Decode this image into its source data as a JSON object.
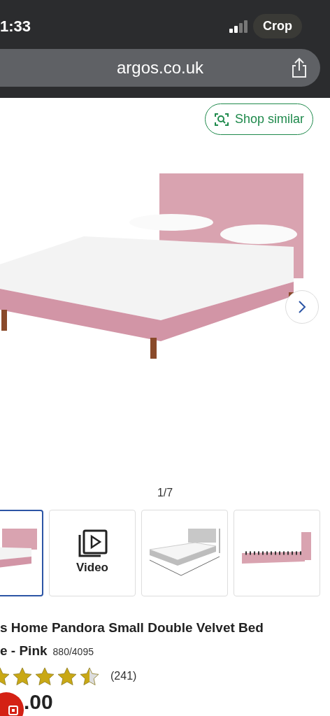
{
  "status_bar": {
    "time": "1:33",
    "crop_label": "Crop"
  },
  "address_bar": {
    "url": "argos.co.uk"
  },
  "shop_similar": {
    "label": "Shop similar"
  },
  "gallery": {
    "counter": "1/7",
    "thumbnails": [
      {
        "kind": "photo",
        "selected": true
      },
      {
        "kind": "video",
        "label": "Video",
        "selected": false
      },
      {
        "kind": "diagram",
        "selected": false
      },
      {
        "kind": "frame",
        "selected": false
      }
    ]
  },
  "product": {
    "title_line_1": "s Home Pandora Small Double Velvet Bed",
    "title_line_2": "e - Pink",
    "catalogue_number": "880/4095",
    "stars": 4.5,
    "review_count": "(241)",
    "price": ".00"
  }
}
